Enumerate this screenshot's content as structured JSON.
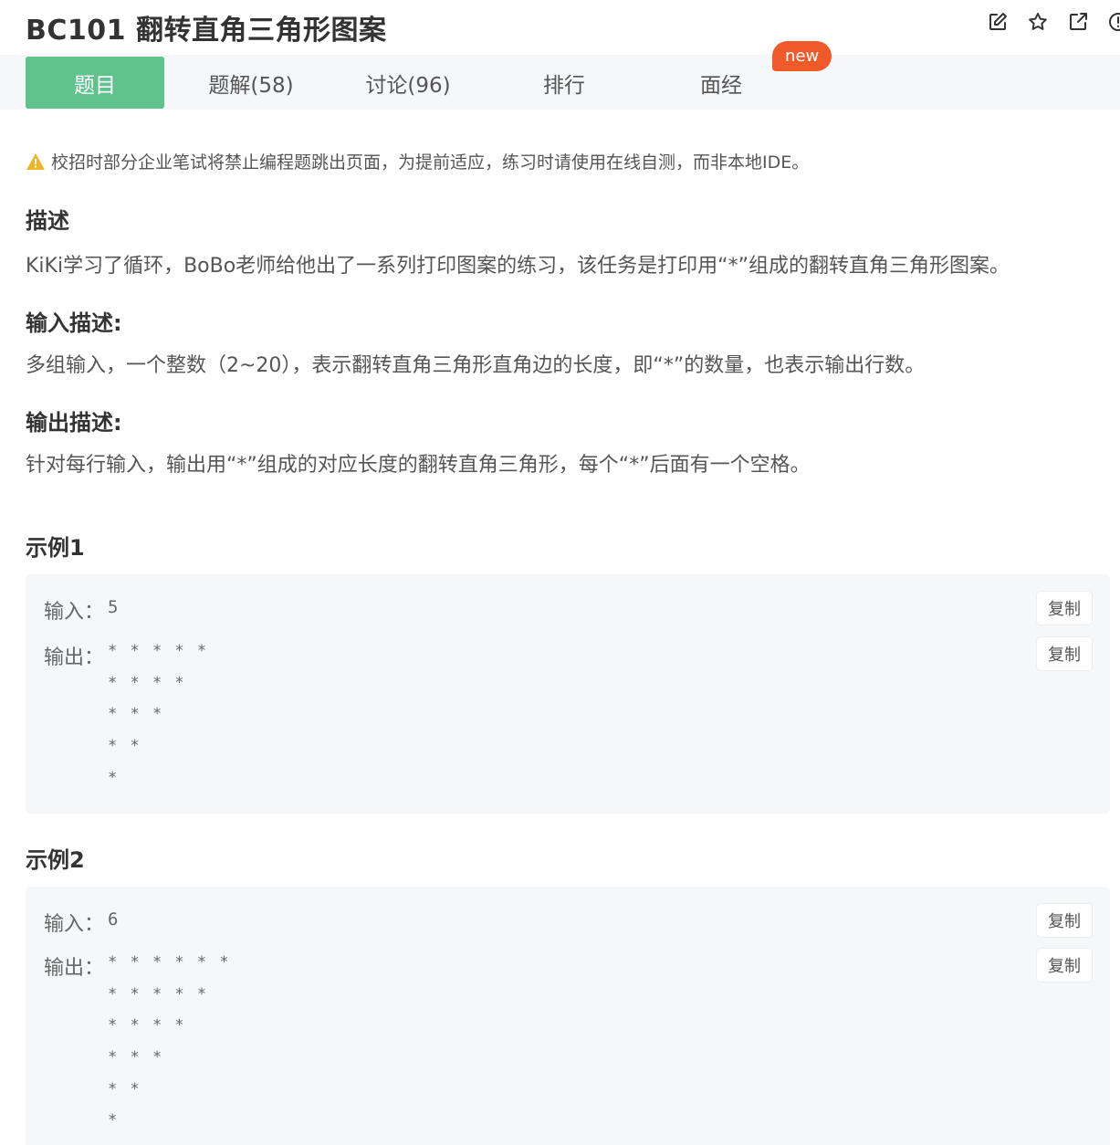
{
  "title": "BC101  翻转直角三角形图案",
  "toolbar": {
    "icons": [
      "edit-icon",
      "star-icon",
      "share-icon",
      "info-icon"
    ]
  },
  "tabs": [
    {
      "label": "题目",
      "active": true
    },
    {
      "label": "题解(58)",
      "active": false
    },
    {
      "label": "讨论(96)",
      "active": false
    },
    {
      "label": "排行",
      "active": false
    },
    {
      "label": "面经",
      "active": false
    }
  ],
  "new_badge": "new",
  "notice": "校招时部分企业笔试将禁止编程题跳出页面，为提前适应，练习时请使用在线自测，而非本地IDE。",
  "description": {
    "heading": "描述",
    "text": "KiKi学习了循环，BoBo老师给他出了一系列打印图案的练习，该任务是打印用“*”组成的翻转直角三角形图案。"
  },
  "input_desc": {
    "heading": "输入描述:",
    "text": "多组输入，一个整数（2~20），表示翻转直角三角形直角边的长度，即“*”的数量，也表示输出行数。"
  },
  "output_desc": {
    "heading": "输出描述:",
    "text": "针对每行输入，输出用“*”组成的对应长度的翻转直角三角形，每个“*”后面有一个空格。"
  },
  "examples": [
    {
      "heading": "示例1",
      "input_label": "输入：",
      "input_value": "5",
      "output_label": "输出：",
      "output_lines": [
        "* * * * *",
        "* * * *",
        "* * *",
        "* *",
        "*"
      ],
      "copy_label": "复制"
    },
    {
      "heading": "示例2",
      "input_label": "输入：",
      "input_value": "6",
      "output_label": "输出：",
      "output_lines": [
        "* * * * * *",
        "* * * * *",
        "* * * *",
        "* * *",
        "* *",
        "*"
      ],
      "copy_label": "复制"
    }
  ],
  "colors": {
    "active_tab": "#5fc38b",
    "new_badge": "#f05a2a",
    "example_bg": "#f6f7f9",
    "warning": "#f0b429"
  }
}
